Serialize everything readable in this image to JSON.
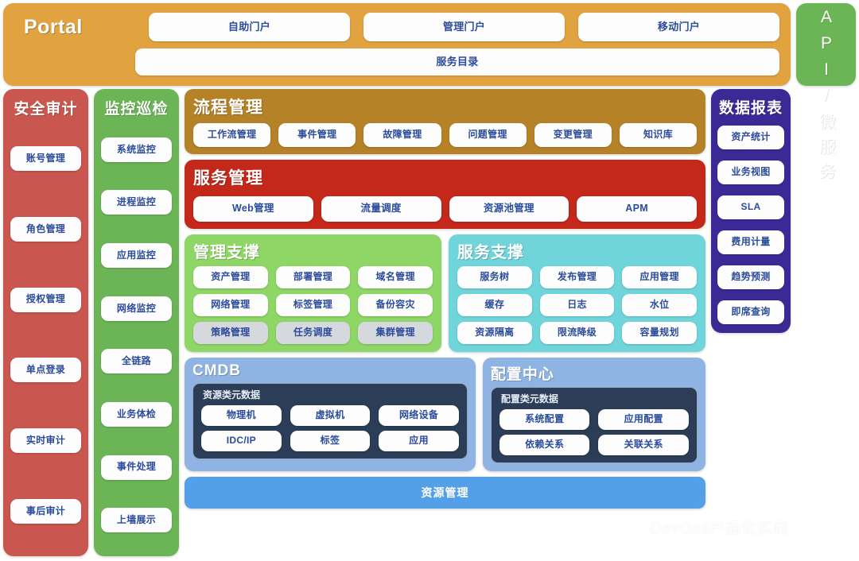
{
  "portal": {
    "logo": "Portal",
    "tabs": [
      "自助门户",
      "管理门户",
      "移动门户"
    ],
    "catalog": "服务目录",
    "color": "#e0a33f"
  },
  "openapi": {
    "label": "OPENAPI/微服务",
    "color": "#6cb557"
  },
  "security_audit": {
    "title": "安全审计",
    "color": "#c9564f",
    "items": [
      "账号管理",
      "角色管理",
      "授权管理",
      "单点登录",
      "实时审计",
      "事后审计"
    ]
  },
  "monitor_inspect": {
    "title": "监控巡检",
    "color": "#6cb557",
    "items": [
      "系统监控",
      "进程监控",
      "应用监控",
      "网络监控",
      "全链路",
      "业务体检",
      "事件处理",
      "上墙展示"
    ]
  },
  "process_mgmt": {
    "title": "流程管理",
    "color": "#b58227",
    "items": [
      "工作流管理",
      "事件管理",
      "故障管理",
      "问题管理",
      "变更管理",
      "知识库"
    ]
  },
  "service_mgmt": {
    "title": "服务管理",
    "color": "#c3281a",
    "items": [
      "Web管理",
      "流量调度",
      "资源池管理",
      "APM"
    ]
  },
  "mgmt_support": {
    "title": "管理支撑",
    "color": "#8ed666",
    "items": [
      {
        "label": "资产管理",
        "muted": false
      },
      {
        "label": "部署管理",
        "muted": false
      },
      {
        "label": "域名管理",
        "muted": false
      },
      {
        "label": "网络管理",
        "muted": false
      },
      {
        "label": "标签管理",
        "muted": false
      },
      {
        "label": "备份容灾",
        "muted": false
      },
      {
        "label": "策略管理",
        "muted": true
      },
      {
        "label": "任务调度",
        "muted": true
      },
      {
        "label": "集群管理",
        "muted": true
      }
    ]
  },
  "svc_support": {
    "title": "服务支撑",
    "color": "#6fd5da",
    "items": [
      {
        "label": "服务树",
        "muted": false
      },
      {
        "label": "发布管理",
        "muted": false
      },
      {
        "label": "应用管理",
        "muted": false
      },
      {
        "label": "缓存",
        "muted": false
      },
      {
        "label": "日志",
        "muted": false
      },
      {
        "label": "水位",
        "muted": false
      },
      {
        "label": "资源隔离",
        "muted": false
      },
      {
        "label": "限流降级",
        "muted": false
      },
      {
        "label": "容量规划",
        "muted": false
      }
    ]
  },
  "cmdb": {
    "title": "CMDB",
    "color": "#8fb4e3",
    "inner_title": "资源类元数据",
    "inner_color": "#2b3d57",
    "items": [
      "物理机",
      "虚拟机",
      "网络设备",
      "IDC/IP",
      "标签",
      "应用"
    ]
  },
  "config_center": {
    "title": "配置中心",
    "color": "#8fb4e3",
    "inner_title": "配置类元数据",
    "inner_color": "#2b3d57",
    "items": [
      "系统配置",
      "应用配置",
      "依赖关系",
      "关联关系"
    ]
  },
  "resource_mgmt": {
    "label": "资源管理",
    "color": "#54a0e8"
  },
  "data_report": {
    "title": "数据报表",
    "color": "#3b2a96",
    "items": [
      "资产统计",
      "业务视图",
      "SLA",
      "费用计量",
      "趋势预测",
      "即席查询"
    ]
  },
  "watermark": {
    "text": "DevOps产品化实践",
    "icon": "wechat-icon"
  }
}
